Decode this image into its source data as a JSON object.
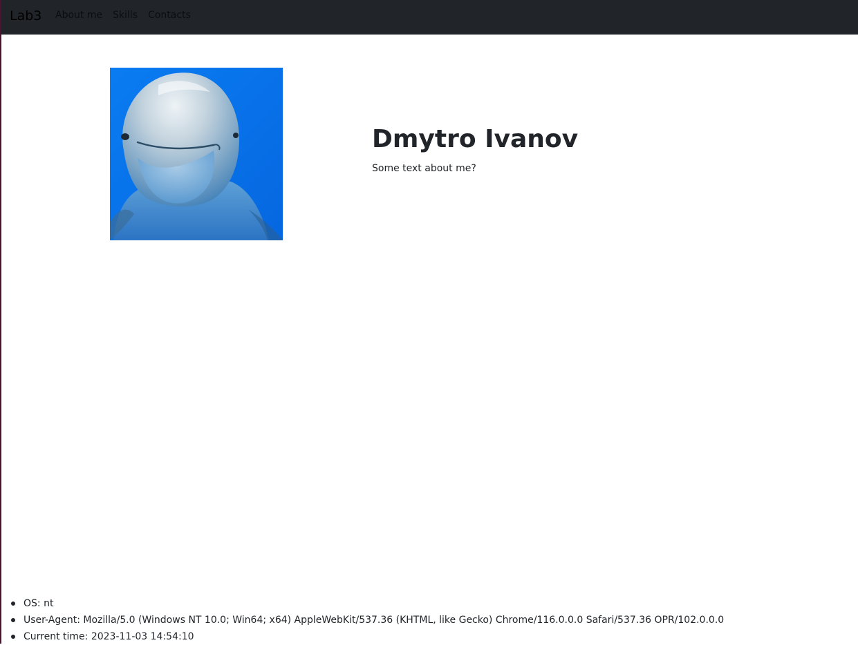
{
  "navbar": {
    "brand": "Lab3",
    "links": [
      {
        "label": "About me"
      },
      {
        "label": "Skills"
      },
      {
        "label": "Contacts"
      }
    ]
  },
  "profile": {
    "name": "Dmytro Ivanov",
    "about": "Some text about me?"
  },
  "info": {
    "os": "OS: nt",
    "user_agent": "User-Agent: Mozilla/5.0 (Windows NT 10.0; Win64; x64) AppleWebKit/537.36 (KHTML, like Gecko) Chrome/116.0.0.0 Safari/537.36 OPR/102.0.0.0",
    "current_time": "Current time: 2023-11-03 14:54:10"
  },
  "colors": {
    "navbar_bg": "#212529",
    "text": "#212529",
    "photo_bg": "#0a78f0"
  }
}
